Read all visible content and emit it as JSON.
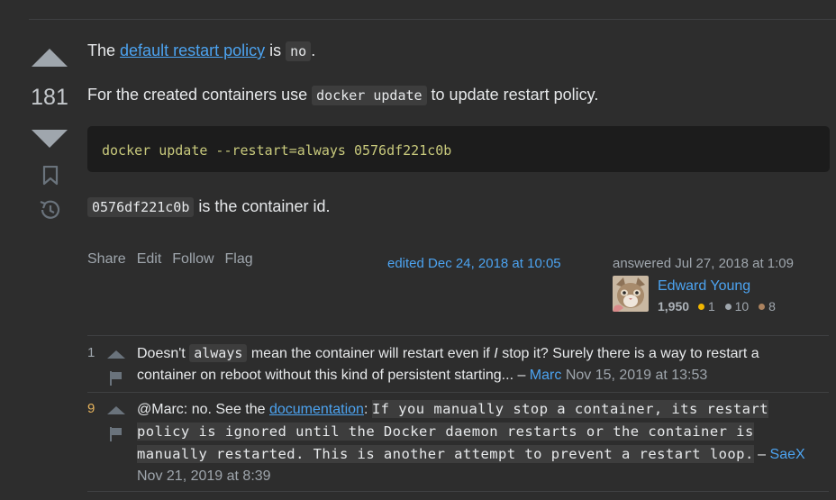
{
  "vote": {
    "count": "181"
  },
  "answer": {
    "p1": {
      "before": "The ",
      "link": "default restart policy",
      "middle": " is ",
      "code": "no",
      "after": "."
    },
    "p2": {
      "before": "For the created containers use ",
      "code": "docker update",
      "after": " to update restart policy."
    },
    "codeblock": "docker update --restart=always 0576df221c0b",
    "p3": {
      "code": "0576df221c0b",
      "after": " is the container id."
    }
  },
  "actions": {
    "share": "Share",
    "edit": "Edit",
    "follow": "Follow",
    "flag": "Flag"
  },
  "edited": "edited Dec 24, 2018 at 10:05",
  "answered": "answered Jul 27, 2018 at 1:09",
  "user": {
    "name": "Edward Young",
    "reputation": "1,950",
    "gold": "1",
    "silver": "10",
    "bronze": "8",
    "gold_color": "#f1b600",
    "silver_color": "#9fa6ad",
    "bronze_color": "#ab825f"
  },
  "comments": [
    {
      "score": "1",
      "score_color": "#9fa6ad",
      "line1_a": "Doesn't ",
      "code": "always",
      "line1_b": " mean the container will restart even if ",
      "em": "I",
      "line1_c": " stop it? Surely there is a way to restart a",
      "line2": "container on reboot without this kind of persistent starting... – ",
      "user": "Marc",
      "date": "Nov 15, 2019 at 13:53"
    },
    {
      "score": "9",
      "score_color": "#e6b35c",
      "prefix": "@Marc: no. See the ",
      "link": "documentation",
      "colon": ": ",
      "code_l1": "If you manually stop a container, its restart",
      "code_l2": "policy is ignored until the Docker daemon restarts or the container is",
      "code_l3": "manually restarted. This is another attempt to prevent a restart loop.",
      "dash": " – ",
      "user": "SaeX",
      "date": "Nov 21, 2019 at 8:39"
    }
  ]
}
